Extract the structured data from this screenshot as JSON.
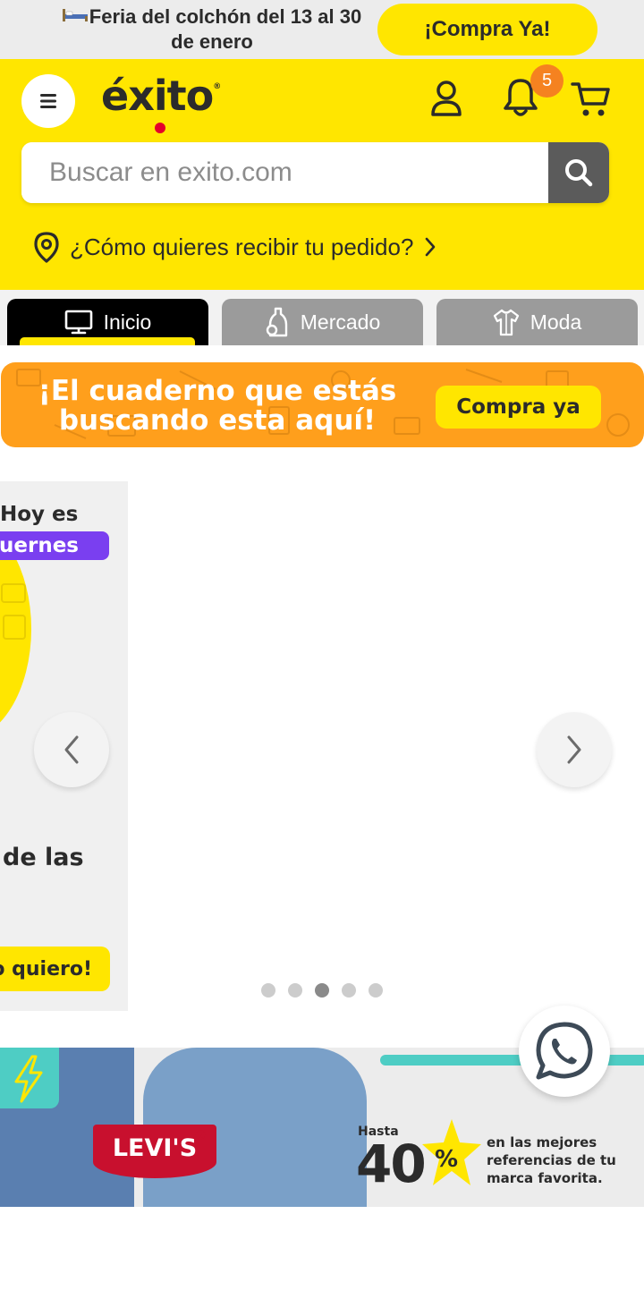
{
  "promo_strip": {
    "text": "Feria del colchón del 13 al 30 de enero",
    "button_label": "¡Compra Ya!"
  },
  "header": {
    "logo_text": "éxito",
    "logo_reg": "®",
    "notification_count": "5",
    "icons": [
      "menu-icon",
      "user-icon",
      "bell-icon",
      "cart-icon"
    ]
  },
  "search": {
    "placeholder": "Buscar en exito.com",
    "value": ""
  },
  "delivery": {
    "text": "¿Cómo quieres recibir tu pedido?"
  },
  "tabs": [
    {
      "label": "Inicio",
      "icon": "monitor-icon",
      "active": true
    },
    {
      "label": "Mercado",
      "icon": "bottle-icon",
      "active": false
    },
    {
      "label": "Moda",
      "icon": "shirt-icon",
      "active": false
    }
  ],
  "notebook_banner": {
    "headline": "¡El cuaderno que estás buscando esta aquí!",
    "button_label": "Compra ya"
  },
  "carousel": {
    "slide_peek": {
      "line1": "Hoy es",
      "line2": "uernes",
      "line3": "de las",
      "button_label": "o quiero!"
    },
    "dots": 5,
    "active_dot": 3
  },
  "levis_banner": {
    "brand": "LEVI'S",
    "brand_reg": "®",
    "hasta": "Hasta",
    "discount": "40",
    "percent": "%",
    "copy": "en las mejores referencias de tu marca favorita."
  },
  "colors": {
    "brand_yellow": "#ffe600",
    "dark_text": "#2b2b2b",
    "badge_orange": "#f58220",
    "banner_orange": "#ff9f1c",
    "levis_red": "#c8102e",
    "teal": "#4ecdc4"
  }
}
